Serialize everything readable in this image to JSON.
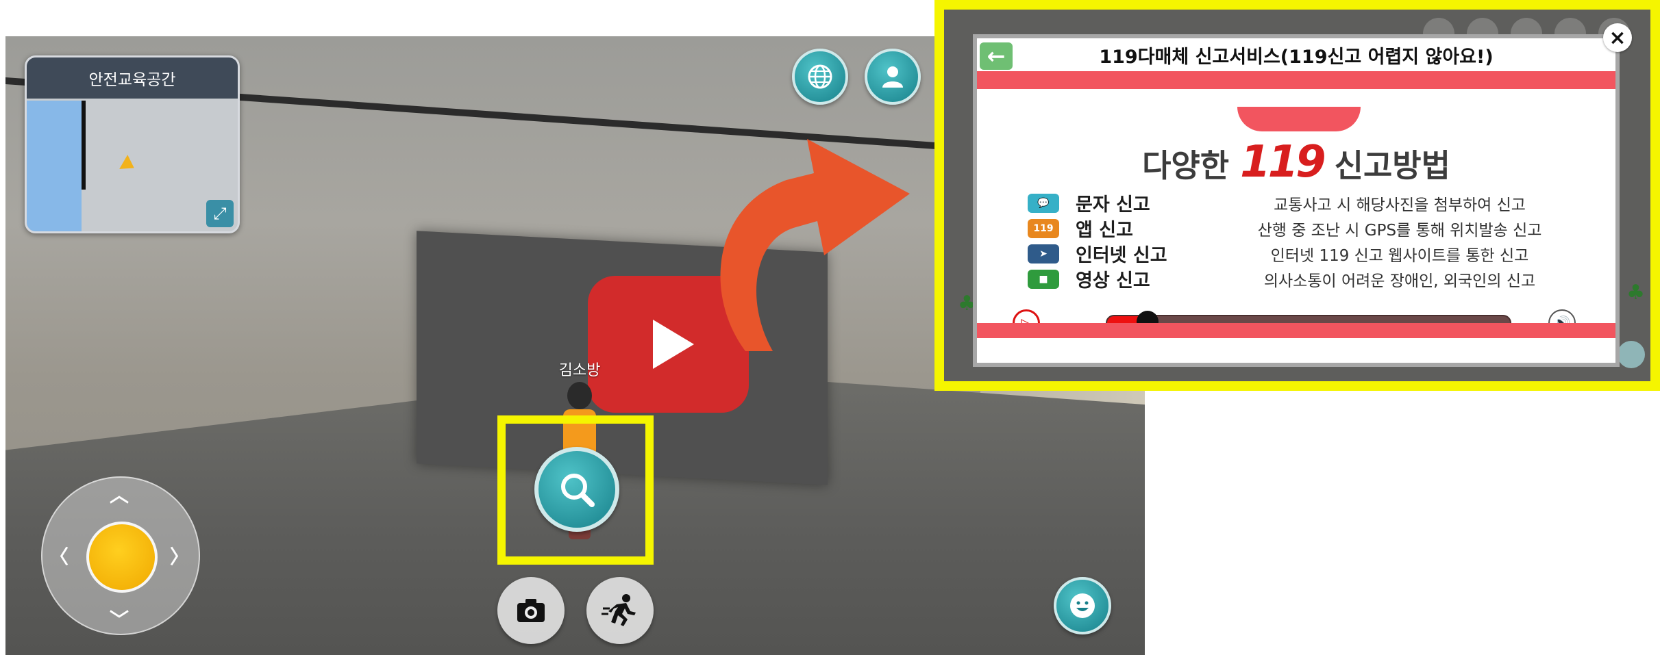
{
  "game": {
    "minimap_title": "안전교육공간",
    "player_name": "김소방",
    "icons": {
      "globe": "globe-icon",
      "profile": "user-icon",
      "search": "search-icon",
      "camera": "camera-icon",
      "run": "run-icon",
      "emoji": "smile-icon",
      "expand": "expand-icon"
    },
    "joystick_arrows": {
      "up": "^",
      "down": "v",
      "left": "<",
      "right": ">"
    },
    "highlight_color": "#f5f500"
  },
  "popup": {
    "title": "119다매체 신고서비스(119신고 어렵지 않아요!)",
    "close_label": "×",
    "back_label": "←",
    "heading_prefix": "다양한",
    "heading_accent": "119",
    "heading_suffix": "신고방법",
    "methods": [
      {
        "icon": "chat-icon",
        "icon_text": "💬",
        "color": "#36b0c7",
        "name": "문자 신고",
        "desc": "교통사고 시 해당사진을 첨부하여 신고"
      },
      {
        "icon": "app-icon",
        "icon_text": "119",
        "color": "#e8871e",
        "name": "앱 신고",
        "desc": "산행 중 조난 시 GPS를 통해 위치발송 신고"
      },
      {
        "icon": "cursor-icon",
        "icon_text": "➤",
        "color": "#2f5b8a",
        "name": "인터넷 신고",
        "desc": "인터넷 119 신고 웹사이트를 통한 신고"
      },
      {
        "icon": "video-icon",
        "icon_text": "■",
        "color": "#2f9b3d",
        "name": "영상 신고",
        "desc": "의사소통이 어려운 장애인, 외국인의 신고"
      }
    ],
    "player": {
      "play_label": "▷",
      "speaker_label": "🔊",
      "progress": 0.1
    },
    "accent_color": "#f2555f"
  }
}
